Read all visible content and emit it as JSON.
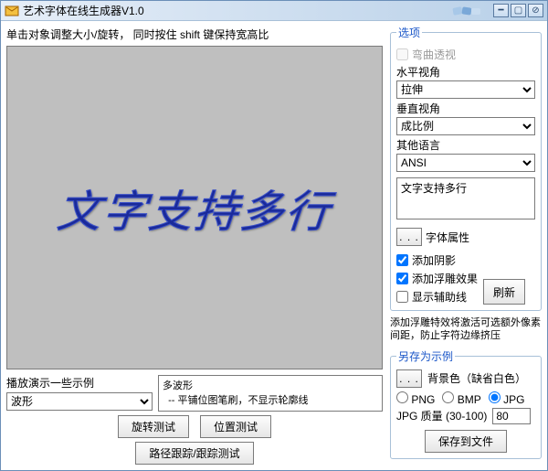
{
  "window": {
    "title": "艺术字体在线生成器V1.0"
  },
  "left": {
    "hint": "单击对象调整大小/旋转，  同时按住 shift 键保持宽高比",
    "canvas_text": "文字支持多行",
    "demo_label": "播放演示一些示例",
    "demo_select": "波形",
    "info_text": "多波形\n  -- 平铺位图笔刷，不显示轮廓线",
    "btn_rotate_test": "旋转测试",
    "btn_position_test": "位置测试",
    "btn_path_test": "路径跟踪/跟踪测试"
  },
  "options": {
    "legend": "选项",
    "curve_perspective": "弯曲透视",
    "h_view_label": "水平视角",
    "h_view_value": "拉伸",
    "v_view_label": "垂直视角",
    "v_view_value": "成比例",
    "other_lang_label": "其他语言",
    "other_lang_value": "ANSI",
    "text_value": "文字支持多行",
    "font_props_btn": "字体属性",
    "shadow": "添加阴影",
    "emboss": "添加浮雕效果",
    "guides": "显示辅助线",
    "refresh": "刷新",
    "note": "添加浮雕特效将激活可选额外像素间距，防止字符边缘挤压"
  },
  "save": {
    "legend": "另存为示例",
    "bgcolor_label": "背景色（缺省白色）",
    "fmt_png": "PNG",
    "fmt_bmp": "BMP",
    "fmt_jpg": "JPG",
    "quality_label": "JPG 质量 (30-100)",
    "quality_value": "80",
    "save_btn": "保存到文件"
  }
}
